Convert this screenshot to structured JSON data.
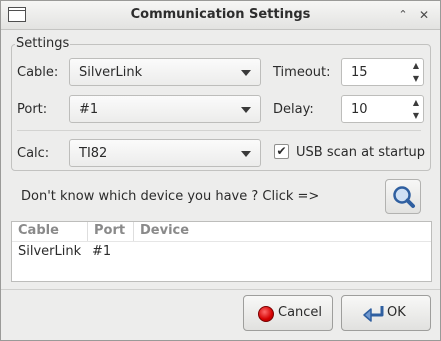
{
  "window": {
    "title": "Communication Settings",
    "titlebar_buttons": {
      "up": "⌃",
      "close": "✕"
    }
  },
  "settings": {
    "group_title": "Settings",
    "cable": {
      "label": "Cable:",
      "value": "SilverLink"
    },
    "port": {
      "label": "Port:",
      "value": "#1"
    },
    "calc": {
      "label": "Calc:",
      "value": "TI82"
    },
    "timeout": {
      "label": "Timeout:",
      "value": "15"
    },
    "delay": {
      "label": "Delay:",
      "value": "10"
    },
    "usb_scan": {
      "label": "USB scan at startup",
      "checked": true,
      "mark": "✔"
    }
  },
  "probe": {
    "text": "Don't know which device you have ? Click =>",
    "icon": "magnifier-icon"
  },
  "device_list": {
    "columns": [
      "Cable",
      "Port",
      "Device"
    ],
    "rows": [
      {
        "cable": "SilverLink",
        "port": "#1",
        "device": ""
      }
    ]
  },
  "buttons": {
    "cancel": "Cancel",
    "ok": "OK"
  },
  "colors": {
    "background": "#ededec",
    "cancel_icon": "#d40000",
    "search_icon": "#2f5fa0"
  }
}
